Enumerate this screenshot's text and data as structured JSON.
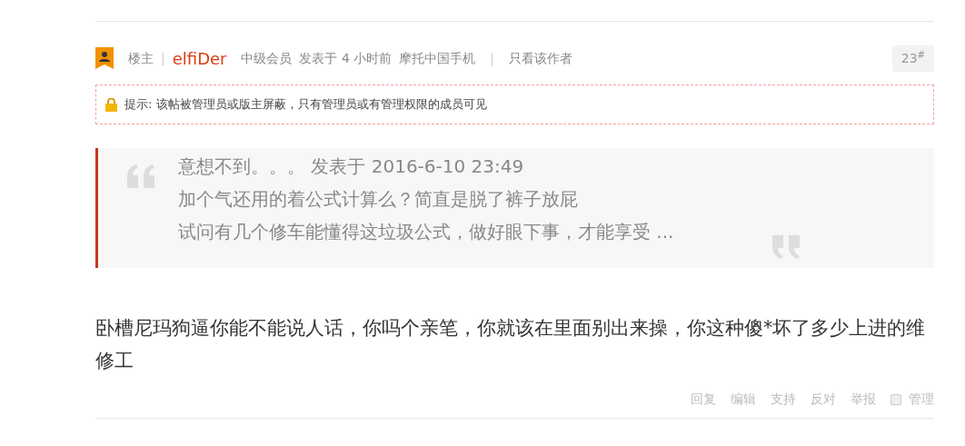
{
  "post": {
    "role": "楼主",
    "separator_1": "|",
    "separator_2": "|",
    "author": "elfiDer",
    "rank": "中级会员",
    "posted": "发表于 4 小时前",
    "source": "摩托中国手机",
    "only_author": "只看该作者",
    "floor": "23",
    "floor_mark": "#"
  },
  "notice": {
    "text": "提示: 该帖被管理员或版主屏蔽，只有管理员或有管理权限的成员可见"
  },
  "quote": {
    "lines": [
      "意想不到。。。 发表于 2016-6-10 23:49",
      "加个气还用的着公式计算么？简直是脱了裤子放屁",
      "试问有几个修车能懂得这垃圾公式，做好眼下事，才能享受 ..."
    ]
  },
  "body": "卧槽尼玛狗逼你能不能说人话，你吗个亲笔，你就该在里面别出来操，你这种傻*坏了多少上进的维修工",
  "actions": [
    {
      "label": "回复",
      "kind": "link"
    },
    {
      "label": "编辑",
      "kind": "link"
    },
    {
      "label": "支持",
      "kind": "link"
    },
    {
      "label": "反对",
      "kind": "link"
    },
    {
      "label": "举报",
      "kind": "link"
    },
    {
      "label": "管理",
      "kind": "check",
      "checked": false
    }
  ]
}
